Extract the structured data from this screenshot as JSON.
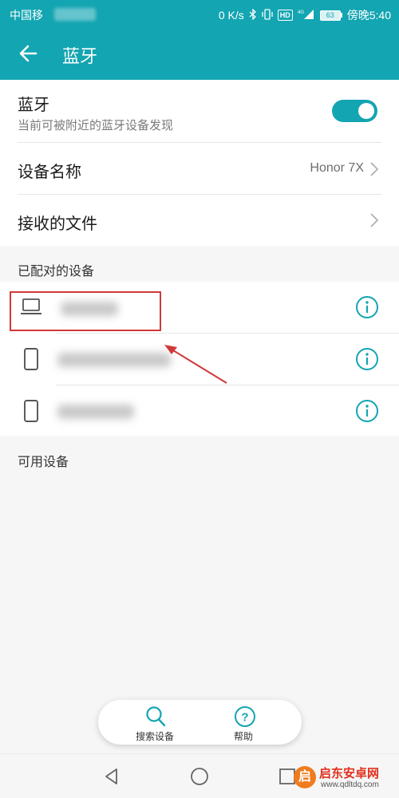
{
  "status_bar": {
    "carrier": "中国移",
    "speed": "0 K/s",
    "hd": "HD",
    "network": "4G",
    "battery": "63",
    "time": "傍晚5:40"
  },
  "app_bar": {
    "title": "蓝牙"
  },
  "bluetooth": {
    "title": "蓝牙",
    "subtitle": "当前可被附近的蓝牙设备发现",
    "enabled": true
  },
  "device_name": {
    "label": "设备名称",
    "value": "Honor 7X"
  },
  "received_files": {
    "label": "接收的文件"
  },
  "paired_section": {
    "title": "已配对的设备"
  },
  "paired_devices": [
    {
      "type": "laptop-icon",
      "name": ""
    },
    {
      "type": "phone-icon",
      "name": ""
    },
    {
      "type": "phone-icon",
      "name": ""
    }
  ],
  "available_section": {
    "title": "可用设备"
  },
  "bottom_actions": {
    "search_label": "搜索设备",
    "help_label": "帮助",
    "help_glyph": "?"
  },
  "colors": {
    "accent": "#13a5b2",
    "highlight": "#d0393a"
  },
  "watermark": {
    "logo_char": "启",
    "text": "启东安卓网",
    "url": "www.qdltdq.com"
  }
}
